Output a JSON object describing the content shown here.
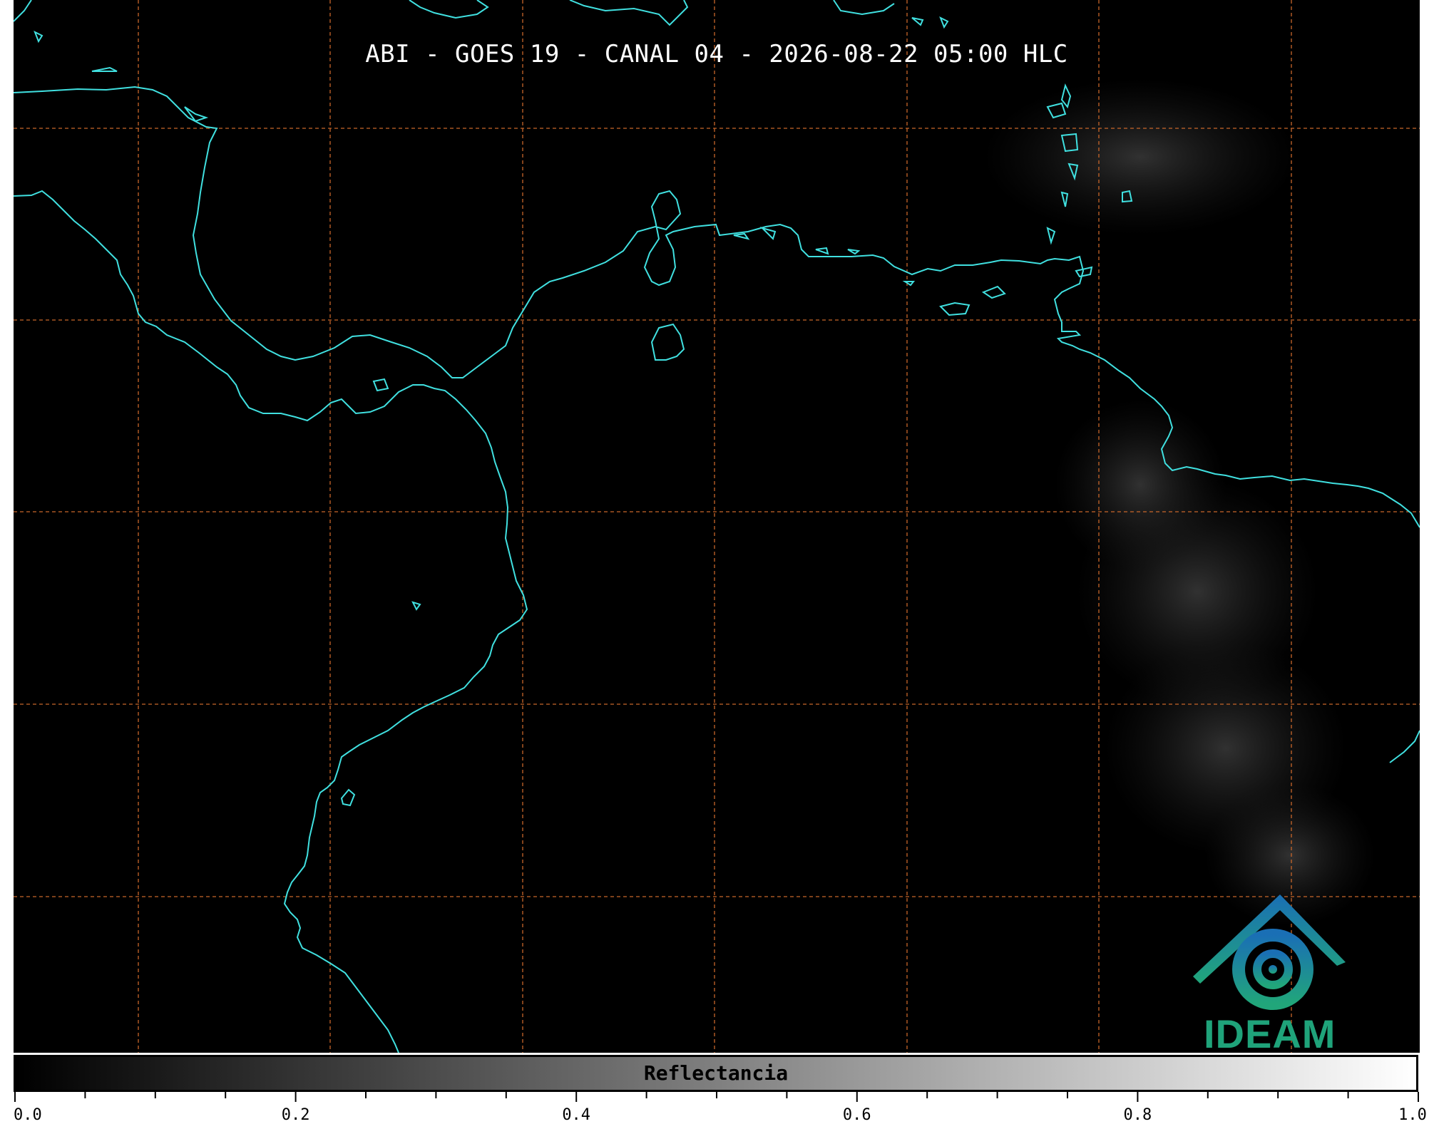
{
  "title": "ABI - GOES 19 - CANAL 04 - 2026-08-22 05:00 HLC",
  "colorbar": {
    "label": "Reflectancia",
    "min": 0.0,
    "max": 1.0,
    "major_ticks": [
      "0.0",
      "0.2",
      "0.4",
      "0.6",
      "0.8",
      "1.0"
    ],
    "colormap": [
      "#000000",
      "#ffffff"
    ]
  },
  "grid": {
    "on": true,
    "color": "#c8662a",
    "style": "dashed"
  },
  "coastline_color": "#40e0e0",
  "logo": {
    "text": "IDEAM",
    "color": "#1fa37a"
  }
}
